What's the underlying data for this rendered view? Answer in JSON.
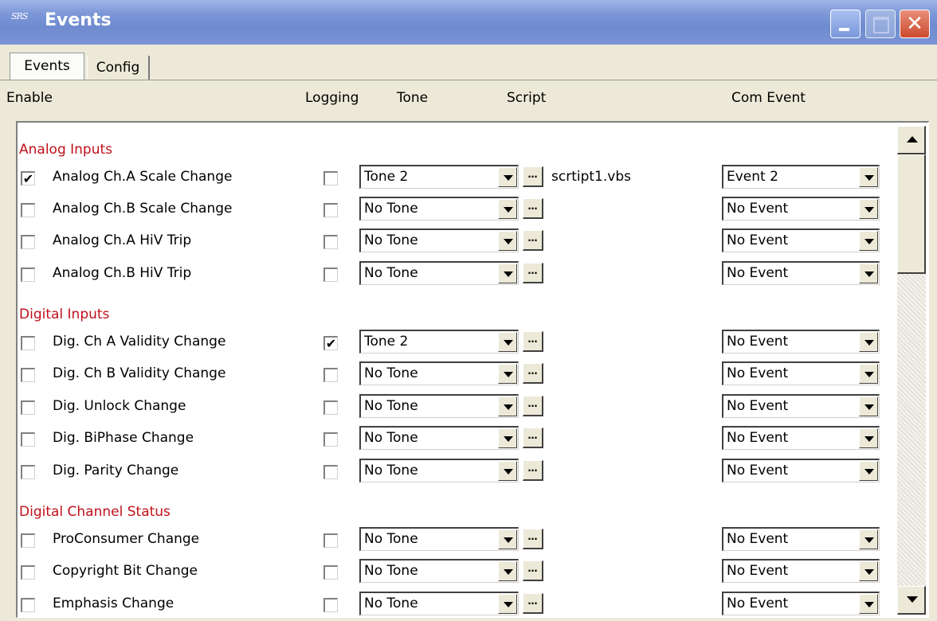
{
  "window": {
    "app_icon": "SRS",
    "title": "Events"
  },
  "tabs": [
    {
      "label": "Events",
      "active": true
    },
    {
      "label": "Config",
      "active": false
    }
  ],
  "headers": {
    "enable": "Enable",
    "logging": "Logging",
    "tone": "Tone",
    "script": "Script",
    "com_event": "Com Event"
  },
  "sections": [
    {
      "title": "Analog Inputs"
    },
    {
      "title": "Digital Inputs"
    },
    {
      "title": "Digital Channel Status"
    }
  ],
  "rows": [
    {
      "enabled": true,
      "label": "Analog Ch.A Scale Change",
      "logging": false,
      "tone": "Tone 2",
      "script": "scrtipt1.vbs",
      "com_event": "Event 2"
    },
    {
      "enabled": false,
      "label": "Analog Ch.B Scale Change",
      "logging": false,
      "tone": "No Tone",
      "script": "",
      "com_event": "No Event"
    },
    {
      "enabled": false,
      "label": "Analog Ch.A HiV Trip",
      "logging": false,
      "tone": "No Tone",
      "script": "",
      "com_event": "No Event"
    },
    {
      "enabled": false,
      "label": "Analog Ch.B HiV Trip",
      "logging": false,
      "tone": "No Tone",
      "script": "",
      "com_event": "No Event"
    },
    {
      "enabled": false,
      "label": "Dig. Ch A Validity Change",
      "logging": true,
      "tone": "Tone 2",
      "script": "",
      "com_event": "No Event"
    },
    {
      "enabled": false,
      "label": "Dig. Ch B Validity Change",
      "logging": false,
      "tone": "No Tone",
      "script": "",
      "com_event": "No Event"
    },
    {
      "enabled": false,
      "label": "Dig. Unlock Change",
      "logging": false,
      "tone": "No Tone",
      "script": "",
      "com_event": "No Event"
    },
    {
      "enabled": false,
      "label": "Dig. BiPhase Change",
      "logging": false,
      "tone": "No Tone",
      "script": "",
      "com_event": "No Event"
    },
    {
      "enabled": false,
      "label": "Dig. Parity Change",
      "logging": false,
      "tone": "No Tone",
      "script": "",
      "com_event": "No Event"
    },
    {
      "enabled": false,
      "label": "ProConsumer Change",
      "logging": false,
      "tone": "No Tone",
      "script": "",
      "com_event": "No Event"
    },
    {
      "enabled": false,
      "label": "Copyright Bit Change",
      "logging": false,
      "tone": "No Tone",
      "script": "",
      "com_event": "No Event"
    },
    {
      "enabled": false,
      "label": "Emphasis Change",
      "logging": false,
      "tone": "No Tone",
      "script": "",
      "com_event": "No Event"
    }
  ],
  "glyphs": {
    "check": "✔",
    "ellipsis": "…",
    "close": "✕"
  }
}
